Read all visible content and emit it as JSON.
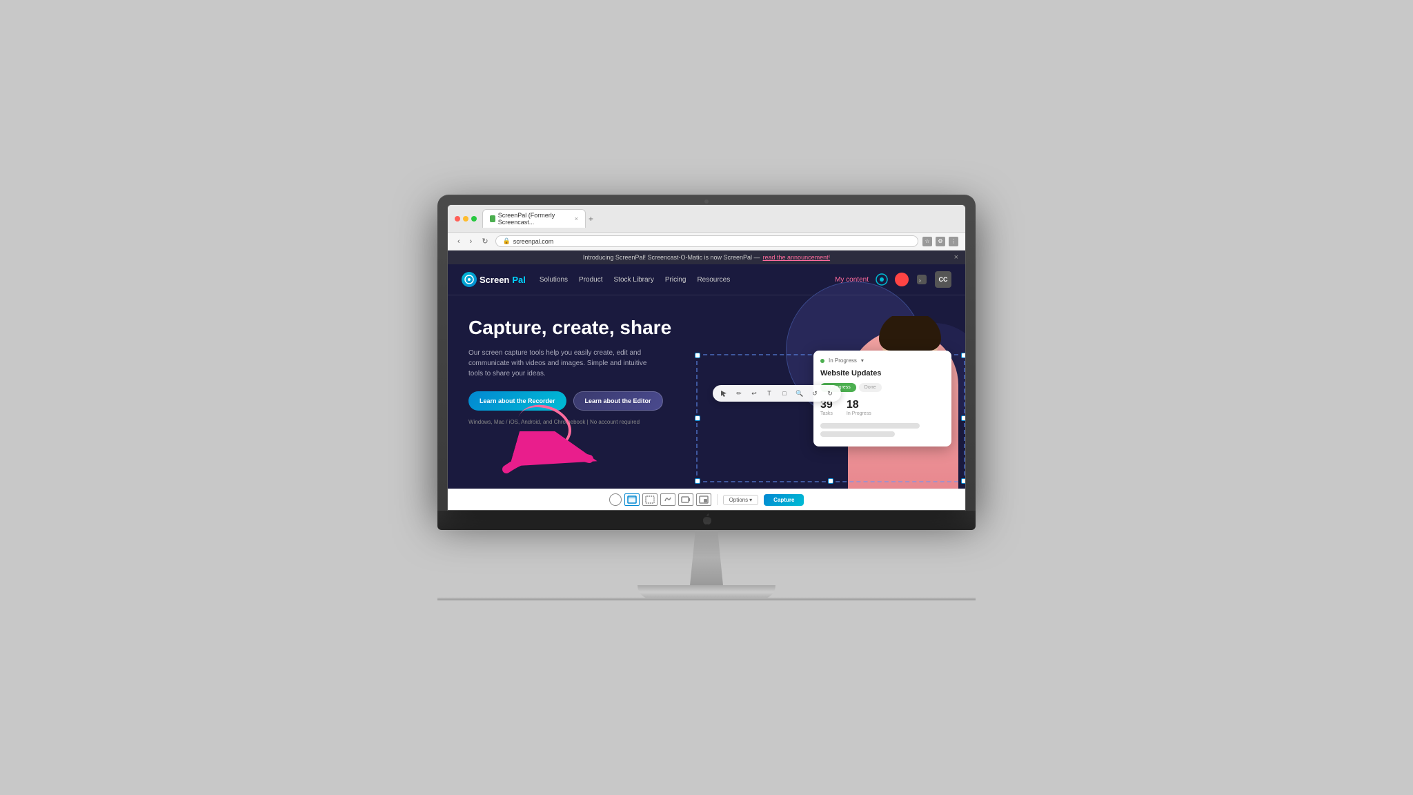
{
  "browser": {
    "tab_title": "ScreenPal (Formerly Screencast...",
    "address": "screenpal.com",
    "tab_close": "×",
    "tab_new": "+"
  },
  "announcement": {
    "text": "Introducing ScreenPal! Screencast-O-Matic is now ScreenPal —",
    "link_text": "read the announcement!",
    "close": "×"
  },
  "nav": {
    "logo_screen": "Screen",
    "logo_pal": "Pal",
    "links": [
      "Solutions",
      "Product",
      "Stock Library",
      "Pricing",
      "Resources"
    ],
    "my_content": "My content",
    "cc": "CC"
  },
  "hero": {
    "title": "Capture, create, share",
    "description": "Our screen capture tools help you easily create, edit and communicate with videos and images. Simple and intuitive tools to share your ideas.",
    "btn_recorder": "Learn about the Recorder",
    "btn_editor": "Learn about the Editor",
    "footnote_platforms": "Windows, Mac / iOS, Android, and Chromebook",
    "footnote_account": "No account required"
  },
  "dashboard_card": {
    "status_label": "In Progress",
    "title": "Website Updates",
    "btn_active": "In Progress",
    "btn_inactive": "Done",
    "tasks_num": "39",
    "tasks_label": "Tasks",
    "progress_num": "18",
    "progress_label": "In Progress"
  },
  "capture_toolbar": {
    "options_label": "Options",
    "capture_label": "Capture"
  }
}
